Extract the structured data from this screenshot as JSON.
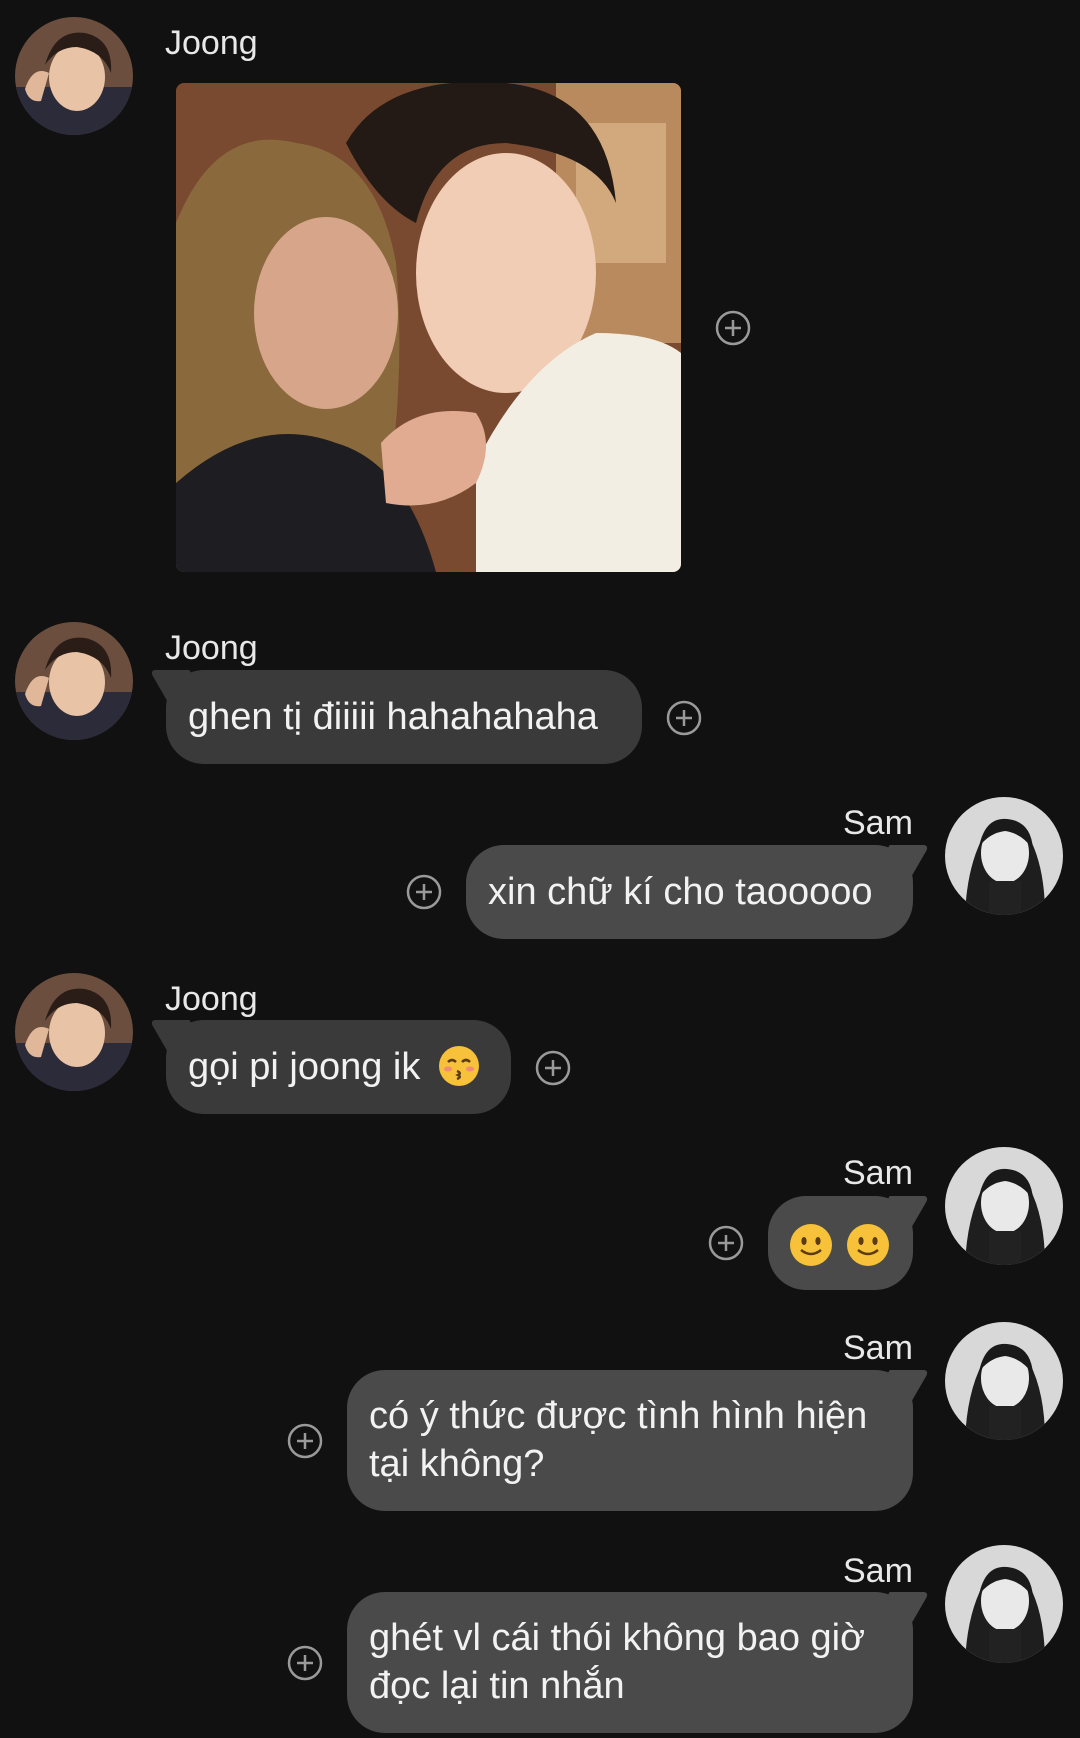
{
  "contacts": {
    "joong": {
      "name": "Joong",
      "avatar_icon": "joong-avatar"
    },
    "sam": {
      "name": "Sam",
      "avatar_icon": "sam-avatar"
    }
  },
  "messages": [
    {
      "from": "Joong",
      "type": "photo",
      "content": "selfie photo",
      "action_icon": "add-reaction-icon"
    },
    {
      "from": "Joong",
      "type": "text",
      "text": "ghen tị điiiii hahahahaha",
      "action_icon": "add-reaction-icon"
    },
    {
      "from": "Sam",
      "type": "text",
      "text": "xin chữ kí cho taooooo",
      "action_icon": "add-reaction-icon"
    },
    {
      "from": "Joong",
      "type": "text",
      "text": "gọi pi joong ik",
      "emoji": "kissing-face-icon",
      "action_icon": "add-reaction-icon"
    },
    {
      "from": "Sam",
      "type": "emoji",
      "emoji": [
        "slightly-smiling-face-icon",
        "slightly-smiling-face-icon"
      ],
      "action_icon": "add-reaction-icon"
    },
    {
      "from": "Sam",
      "type": "text",
      "lines": [
        "có ý thức được tình hình hiện",
        "tại không?"
      ],
      "action_icon": "add-reaction-icon"
    },
    {
      "from": "Sam",
      "type": "text",
      "lines": [
        "ghét vl cái thói không bao giờ",
        "đọc lại tin nhắn"
      ],
      "action_icon": "add-reaction-icon"
    }
  ],
  "colors": {
    "background": "#111111",
    "incoming_bubble": "#3a3a3a",
    "outgoing_bubble": "#4a4a4a",
    "text": "#f2f2f2"
  }
}
